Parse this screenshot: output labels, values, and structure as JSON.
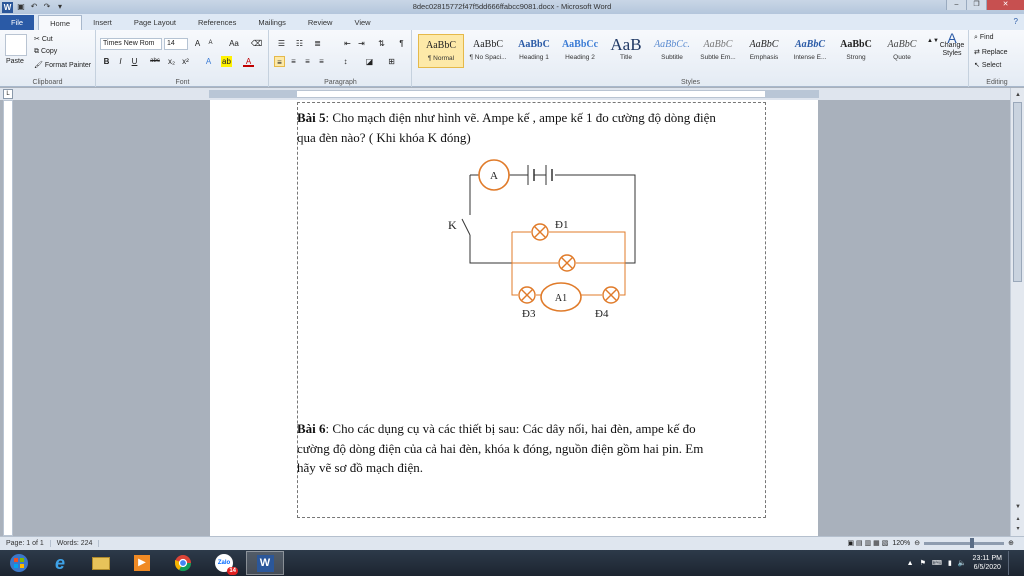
{
  "window": {
    "title": "8dec02815772f47f5dd666ffabcc9081.docx - Microsoft Word",
    "controls": [
      "–",
      "❐",
      "✕"
    ]
  },
  "tabs": [
    "File",
    "Home",
    "Insert",
    "Page Layout",
    "References",
    "Mailings",
    "Review",
    "View"
  ],
  "ribbon": {
    "clipboard": {
      "label": "Clipboard",
      "paste": "Paste",
      "cut": "Cut",
      "copy": "Copy",
      "format_painter": "Format Painter"
    },
    "font": {
      "label": "Font",
      "font_name": "Times New Rom",
      "font_size": "14",
      "bold": "B",
      "italic": "I",
      "underline": "U",
      "strike": "abc",
      "sub": "x₂",
      "sup": "x²",
      "case": "Aa"
    },
    "paragraph": {
      "label": "Paragraph"
    },
    "styles": {
      "label": "Styles",
      "items": [
        {
          "preview": "AaBbC",
          "name": "¶ Normal"
        },
        {
          "preview": "AaBbC",
          "name": "¶ No Spaci..."
        },
        {
          "preview": "AaBbC",
          "name": "Heading 1"
        },
        {
          "preview": "AaBbCc",
          "name": "Heading 2"
        },
        {
          "preview": "AaB",
          "name": "Title"
        },
        {
          "preview": "AaBbCc.",
          "name": "Subtitle"
        },
        {
          "preview": "AaBbC",
          "name": "Subtle Em..."
        },
        {
          "preview": "AaBbC",
          "name": "Emphasis"
        },
        {
          "preview": "AaBbC",
          "name": "Intense E..."
        },
        {
          "preview": "AaBbC",
          "name": "Strong"
        },
        {
          "preview": "AaBbC",
          "name": "Quote"
        }
      ],
      "change_styles": "Change Styles"
    },
    "editing": {
      "label": "Editing",
      "find": "Find",
      "replace": "Replace",
      "select": "Select"
    }
  },
  "document": {
    "bai5_label": "Bài 5",
    "bai5_line1": ": Cho mạch điện như hình vẽ. Ampe kế , ampe kế 1 đo cường độ dòng điện",
    "bai5_line2": "qua đèn nào? ( Khi khóa K đóng)",
    "bai6_label": "Bài 6",
    "bai6_line1": ": Cho các dụng cụ và các thiết bị sau: Các dây nối, hai đèn, ampe kế đo",
    "bai6_line2": "cường độ dòng điện của cả hai đèn, khóa k đóng, nguồn điện gồm hai pin. Em",
    "bai6_line3": "hãy vẽ sơ đồ mạch điện.",
    "circuit": {
      "ammeter_label": "A",
      "ammeter1_label": "A1",
      "switch_label": "K",
      "lamp1_label": "Đ1",
      "lamp3_label": "Đ3",
      "lamp4_label": "Đ4",
      "wire_color": "#333333",
      "element_color": "#e07b2a"
    }
  },
  "status": {
    "page": "Page: 1 of 1",
    "words": "Words: 224",
    "zoom": "120%"
  },
  "taskbar": {
    "time": "23:11 PM",
    "date": "6/5/2020",
    "badge": "14"
  }
}
